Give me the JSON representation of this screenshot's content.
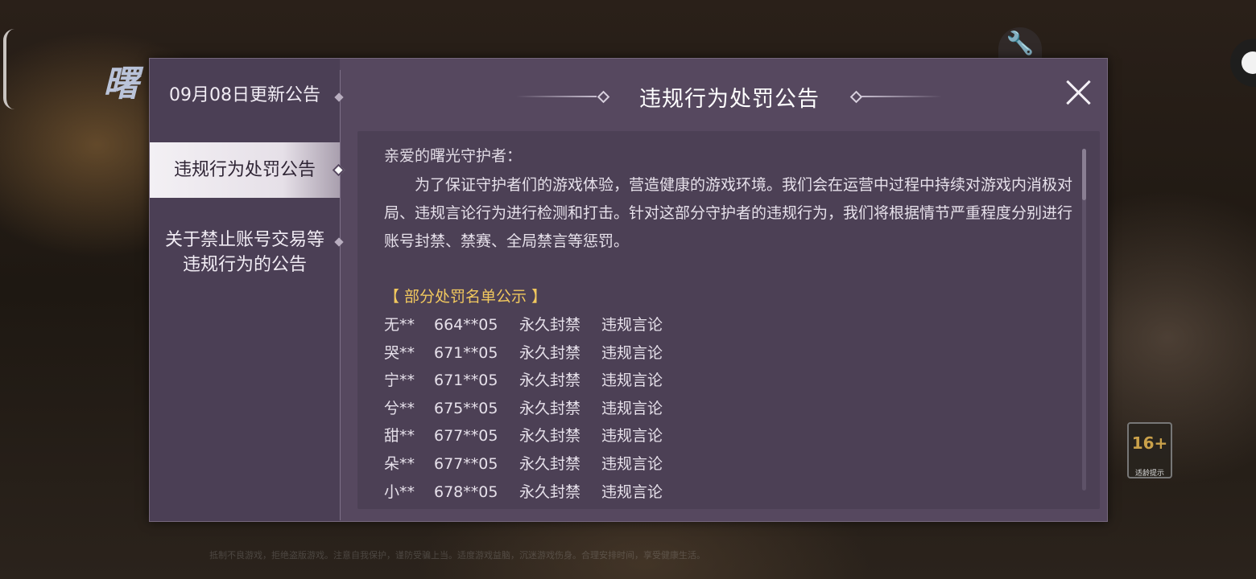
{
  "background": {
    "logo_text": "曙",
    "footer_text": "抵制不良游戏，拒绝盗版游戏。注意自我保护，谨防受骗上当。适度游戏益脑，沉迷游戏伤身。合理安排时间，享受健康生活。"
  },
  "hud": {
    "age_rating": "16+",
    "age_rating_label": "适龄提示"
  },
  "sidebar": {
    "items": [
      {
        "label": "09月08日更新公告"
      },
      {
        "label": "违规行为处罚公告"
      },
      {
        "label_line1": "关于禁止账号交易等",
        "label_line2": "违规行为的公告"
      }
    ]
  },
  "header": {
    "title": "违规行为处罚公告"
  },
  "content": {
    "greeting": "亲爱的曙光守护者：",
    "paragraph": "为了保证守护者们的游戏体验，营造健康的游戏环境。我们会在运营中过程中持续对游戏内消极对局、违规言论行为进行检测和打击。针对这部分守护者的违规行为，我们将根据情节严重程度分别进行账号封禁、禁赛、全局禁言等惩罚。",
    "section_title": "【 部分处罚名单公示 】",
    "rows": [
      {
        "name": "无**",
        "id": "664**05",
        "penalty": "永久封禁",
        "reason": "违规言论"
      },
      {
        "name": "哭**",
        "id": "671**05",
        "penalty": "永久封禁",
        "reason": "违规言论"
      },
      {
        "name": "宁**",
        "id": "671**05",
        "penalty": "永久封禁",
        "reason": "违规言论"
      },
      {
        "name": "兮**",
        "id": "675**05",
        "penalty": "永久封禁",
        "reason": "违规言论"
      },
      {
        "name": "甜**",
        "id": "677**05",
        "penalty": "永久封禁",
        "reason": "违规言论"
      },
      {
        "name": "朵**",
        "id": "677**05",
        "penalty": "永久封禁",
        "reason": "违规言论"
      },
      {
        "name": "小**",
        "id": "678**05",
        "penalty": "永久封禁",
        "reason": "违规言论"
      }
    ]
  },
  "colors": {
    "panel": "#56485f",
    "sidebar": "#4b3f55",
    "content": "#4c4055",
    "highlight": "#f1c85e"
  }
}
